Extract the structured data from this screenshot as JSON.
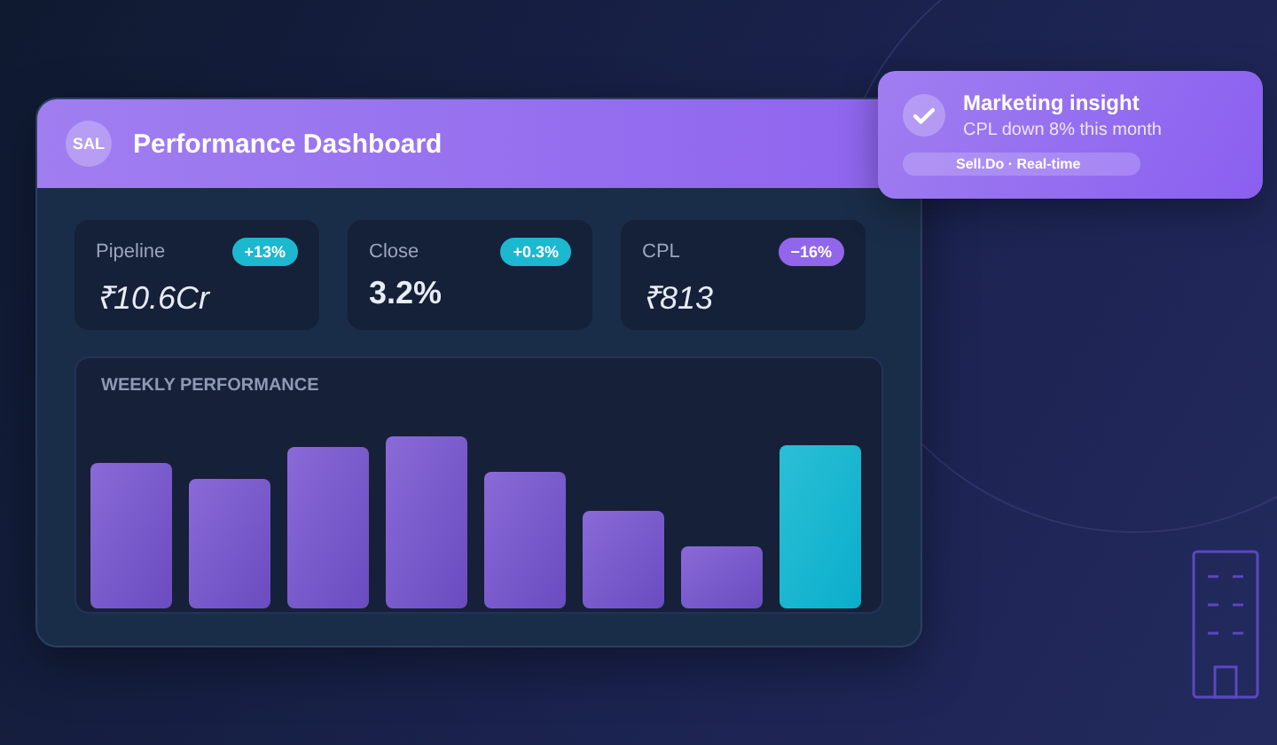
{
  "dashboard": {
    "avatar": "SAL",
    "title": "Performance Dashboard",
    "metrics": [
      {
        "label": "Pipeline",
        "value": "₹10.6Cr",
        "kind": "italic",
        "change": "+13%",
        "color": "#1cb8d0"
      },
      {
        "label": "Close",
        "value": "3.2%",
        "kind": "bold",
        "change": "+0.3%",
        "color": "#1cb8d0"
      },
      {
        "label": "CPL",
        "value": "₹813",
        "kind": "italic",
        "change": "−16%",
        "color": "#9266ea"
      }
    ],
    "chart": {
      "title": "WEEKLY PERFORMANCE"
    }
  },
  "notification": {
    "title": "Marketing insight",
    "message": "CPL down 8% this month",
    "tag": "Sell.Do · Real-time"
  }
}
